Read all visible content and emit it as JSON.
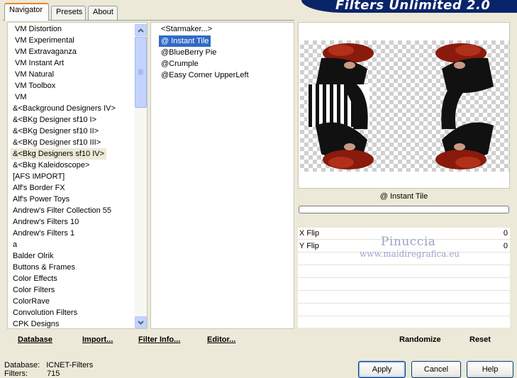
{
  "tabs": [
    {
      "label": "Navigator"
    },
    {
      "label": "Presets"
    },
    {
      "label": "About"
    }
  ],
  "banner": {
    "title": "Filters Unlimited 2.0"
  },
  "categories": [
    {
      "label": "VM Distortion"
    },
    {
      "label": "VM Experimental"
    },
    {
      "label": "VM Extravaganza"
    },
    {
      "label": "VM Instant Art"
    },
    {
      "label": "VM Natural"
    },
    {
      "label": "VM Toolbox"
    },
    {
      "label": "VM"
    },
    {
      "label": "&<Background Designers IV>"
    },
    {
      "label": "&<BKg Designer sf10 I>"
    },
    {
      "label": "&<BKg Designer sf10 II>"
    },
    {
      "label": "&<BKg Designer sf10 III>"
    },
    {
      "label": "&<Bkg Designers sf10 IV>"
    },
    {
      "label": "&<Bkg Kaleidoscope>"
    },
    {
      "label": "[AFS IMPORT]"
    },
    {
      "label": "Alf's Border FX"
    },
    {
      "label": "Alf's Power Toys"
    },
    {
      "label": "Andrew's Filter Collection 55"
    },
    {
      "label": "Andrew's Filters 10"
    },
    {
      "label": "Andrew's Filters 1"
    },
    {
      "label": "a"
    },
    {
      "label": "Balder Olrik"
    },
    {
      "label": "Buttons & Frames"
    },
    {
      "label": "Color Effects"
    },
    {
      "label": "Color Filters"
    },
    {
      "label": "ColorRave"
    },
    {
      "label": "Convolution Filters"
    },
    {
      "label": "CPK Designs"
    }
  ],
  "filters": [
    {
      "label": "<Starmaker...>"
    },
    {
      "label": "@ Instant Tile"
    },
    {
      "label": "@BlueBerry Pie"
    },
    {
      "label": "@Crumple"
    },
    {
      "label": "@Easy Corner UpperLeft"
    }
  ],
  "preview": {
    "filter_name": "@ Instant Tile"
  },
  "params": [
    {
      "label": "X Flip",
      "value": "0"
    },
    {
      "label": "Y Flip",
      "value": "0"
    }
  ],
  "watermark": {
    "line1": "Pinuccia",
    "line2": "www.maidiregrafica.eu"
  },
  "toolbar_left": {
    "database": "Database",
    "import": "Import...",
    "filter_info": "Filter Info...",
    "editor": "Editor..."
  },
  "toolbar_right": {
    "randomize": "Randomize",
    "reset": "Reset"
  },
  "status": {
    "database_label": "Database:",
    "database_value": "ICNET-Filters",
    "filters_label": "Filters:",
    "filters_value": "715"
  },
  "buttons": {
    "apply": "Apply",
    "cancel": "Cancel",
    "help": "Help"
  },
  "colors": {
    "selection": "#316ac5",
    "banner": "#0a246a",
    "window": "#ece9d8"
  }
}
